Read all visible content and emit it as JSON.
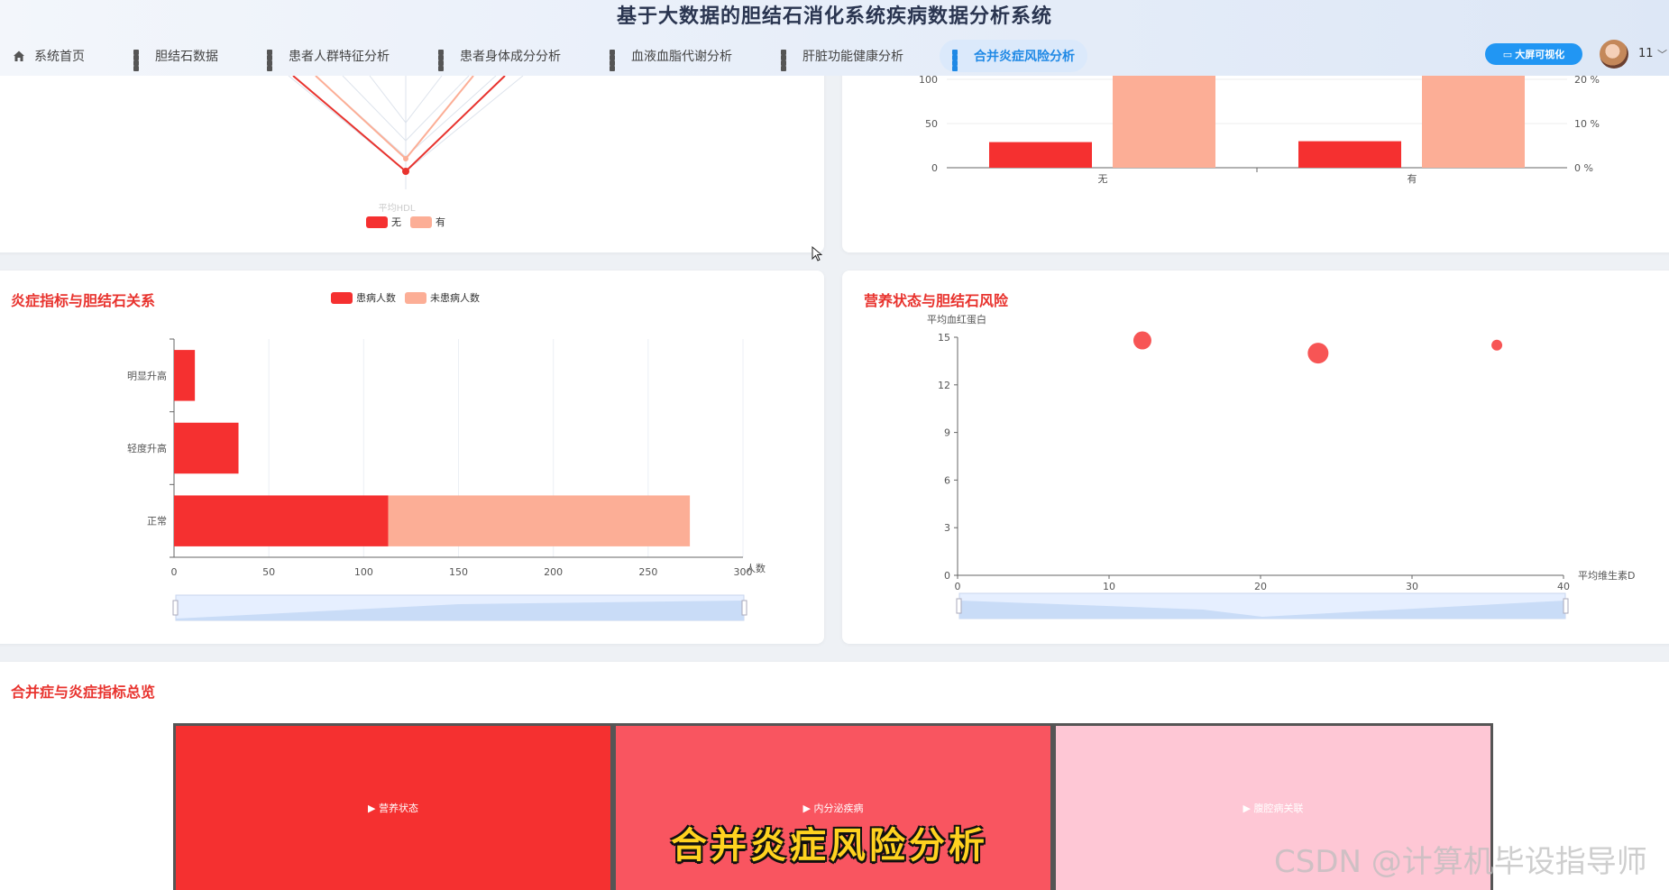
{
  "app": {
    "title": "基于大数据的胆结石消化系统疾病数据分析系统"
  },
  "nav": [
    {
      "label": "系统首页",
      "icon": "home-icon"
    },
    {
      "label": "胆结石数据",
      "icon": "grid-icon"
    },
    {
      "label": "患者人群特征分析",
      "icon": "grid-icon"
    },
    {
      "label": "患者身体成分分析",
      "icon": "grid-icon"
    },
    {
      "label": "血液血脂代谢分析",
      "icon": "grid-icon"
    },
    {
      "label": "肝脏功能健康分析",
      "icon": "grid-icon"
    },
    {
      "label": "合并炎症风险分析",
      "icon": "grid-icon",
      "active": true
    }
  ],
  "header_right": {
    "bigscreen_label": "大屏可视化",
    "user": "11"
  },
  "colors": {
    "primary_red": "#f53030",
    "light_salmon": "#fcae96",
    "accent_blue": "#2196f3"
  },
  "radar_panel": {
    "axis_label": "平均HDL",
    "legend": [
      "无",
      "有"
    ]
  },
  "bar_panel_top": {
    "y_ticks_left": [
      "100",
      "50",
      "0"
    ],
    "y_ticks_right": [
      "20 %",
      "10 %",
      "0 %"
    ],
    "categories": [
      "无",
      "有"
    ]
  },
  "inflammation_panel": {
    "title": "炎症指标与胆结石关系",
    "legend": [
      "患病人数",
      "未患病人数"
    ]
  },
  "nutrition_panel": {
    "title": "营养状态与胆结石风险"
  },
  "treemap_panel": {
    "title": "合并症与炎症指标总览",
    "blocks": [
      "▶ 营养状态",
      "▶ 内分泌疾病",
      "▶ 腹腔病关联"
    ]
  },
  "overlay": {
    "caption": "合并炎症风险分析",
    "watermark": "CSDN @计算机毕设指导师"
  },
  "chart_data": [
    {
      "type": "bar",
      "orientation": "horizontal",
      "stacked": true,
      "title": "炎症指标与胆结石关系",
      "categories": [
        "明显升高",
        "轻度升高",
        "正常"
      ],
      "series": [
        {
          "name": "患病人数",
          "values": [
            11,
            34,
            113
          ]
        },
        {
          "name": "未患病人数",
          "values": [
            0,
            0,
            159
          ]
        }
      ],
      "xlabel": "人数",
      "xlim": [
        0,
        300
      ],
      "x_ticks": [
        "0",
        "50",
        "100",
        "150",
        "200",
        "250",
        "300"
      ]
    },
    {
      "type": "scatter",
      "title": "营养状态与胆结石风险",
      "xlabel": "平均维生素D",
      "ylabel": "平均血红蛋白",
      "xlim": [
        0,
        40
      ],
      "ylim": [
        0,
        15
      ],
      "x_ticks": [
        "0",
        "10",
        "20",
        "30",
        "40"
      ],
      "y_ticks": [
        "0",
        "3",
        "6",
        "9",
        "12",
        "15"
      ],
      "points": [
        {
          "x": 12.2,
          "y": 14.8,
          "size": 1.0
        },
        {
          "x": 23.8,
          "y": 14.0,
          "size": 1.15
        },
        {
          "x": 35.6,
          "y": 14.5,
          "size": 0.6
        }
      ]
    },
    {
      "type": "bar",
      "title": "",
      "categories": [
        "无",
        "有"
      ],
      "series": [
        {
          "name": "",
          "values": [
            29,
            30
          ]
        },
        {
          "name": "",
          "values": [
            105,
            105
          ]
        }
      ],
      "ylim": [
        0,
        100
      ]
    }
  ]
}
